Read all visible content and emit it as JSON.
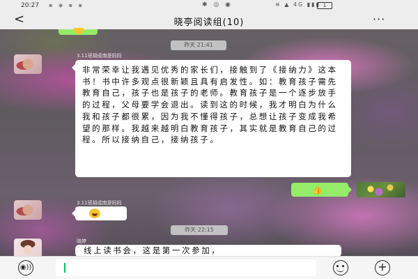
{
  "status_bar": {
    "time": "20:27",
    "left_icons": "▪ ◆ ▪ ▪",
    "center_icons": "✱ ◎ ◉",
    "right_icons": "≋ ▲ 4G ▮▮▮",
    "battery": "1"
  },
  "header": {
    "back_label": "<",
    "title": "晓亭阅读组(10)",
    "more_label": "···"
  },
  "messages": {
    "timestamp_1": "昨天 21:41",
    "sender_1": "3.11班胡成南是妈妈",
    "long_text": "非常荣幸让我遇见优秀的家长们，接触到了《接纳力》这本书！书中许多观点很新颖且具有启发性。如：教育孩子需先教育自己，孩子也是孩子的老师。教育孩子是一个逐步放手的过程，父母要学会退出。读到这的时候，我才明白为什么我和孩子都很累，因为我不懂得孩子，总想让孩子变成我希望的那样。我越来越明白教育孩子，其实就是教育自己的过程。所以接纳自己，接纳孩子。",
    "sent_emoji": "👍",
    "sender_2": "3.11班胡成南是妈妈",
    "laugh_emoji": "😂",
    "timestamp_2": "昨天 22:15",
    "sender_3": "晓婷",
    "last_text": "线上读书会，这是第一次参加，"
  },
  "input_bar": {
    "voice_label": "◉))",
    "plus_label": "+"
  },
  "colors": {
    "sent_bubble": "#95ec69",
    "received_bubble": "#ffffff",
    "bar_background": "#ededed",
    "cursor": "#07c160"
  }
}
